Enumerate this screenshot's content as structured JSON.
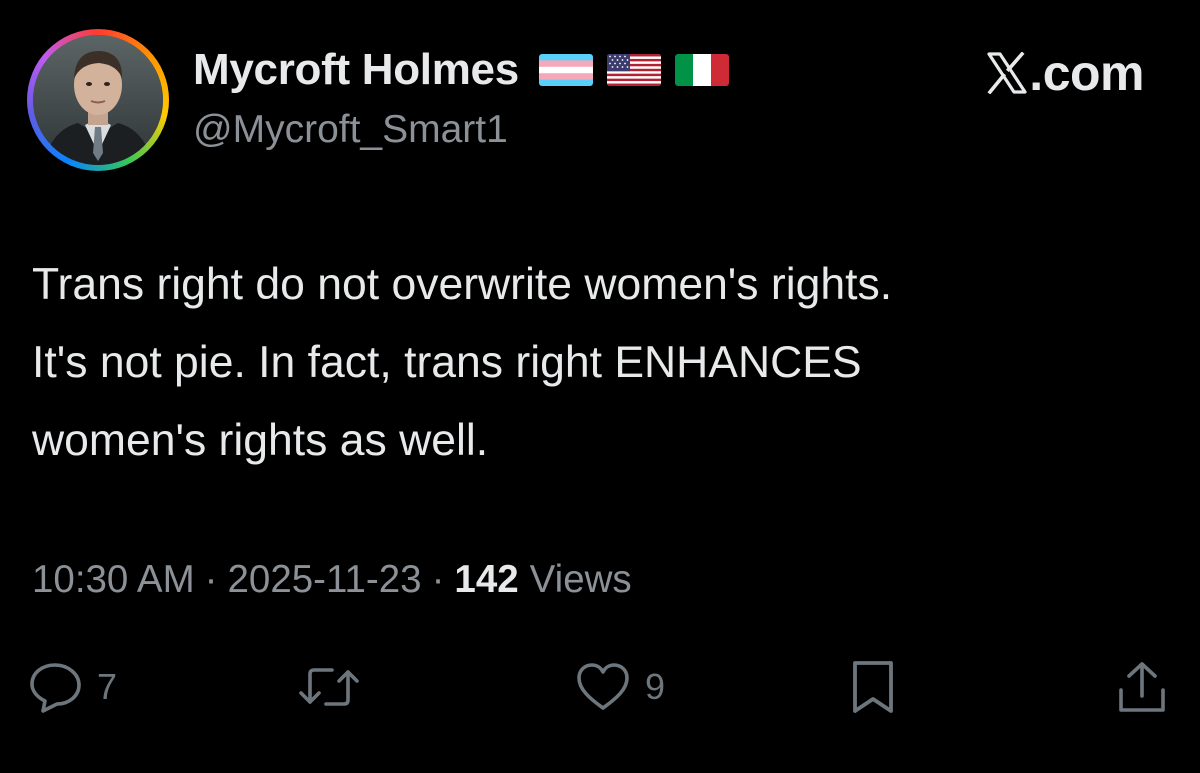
{
  "author": {
    "display_name": "Mycroft Holmes",
    "handle": "@Mycroft_Smart1",
    "flags": [
      "transgender-flag",
      "usa-flag",
      "italy-flag"
    ],
    "avatar": "profile-photo-man-in-suit"
  },
  "site": {
    "label": ".com",
    "logo": "x-logo-icon"
  },
  "tweet": {
    "lines": [
      "Trans right do not overwrite women's rights.",
      "It's not pie. In fact, trans right ENHANCES",
      "women's rights as well."
    ]
  },
  "meta": {
    "time": "10:30 AM",
    "separator": "·",
    "date": "2025-11-23",
    "views_count": "142",
    "views_label": "Views"
  },
  "actions": {
    "reply": {
      "icon": "reply-icon",
      "count": "7"
    },
    "retweet": {
      "icon": "retweet-icon"
    },
    "like": {
      "icon": "heart-icon",
      "count": "9"
    },
    "bookmark": {
      "icon": "bookmark-icon"
    },
    "share": {
      "icon": "share-icon"
    }
  },
  "colors": {
    "background": "#000000",
    "primary_text": "#e7e9ea",
    "secondary_text": "#8b9196",
    "icon": "#6e767d"
  }
}
